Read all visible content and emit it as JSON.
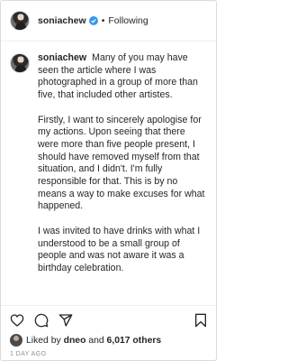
{
  "post": {
    "username": "soniachew",
    "separator": "•",
    "follow_status": "Following",
    "more_glyph": "•••"
  },
  "caption": {
    "username": "soniachew",
    "paragraphs": [
      "Many of you may have seen the article where I was photographed in a group of more than five, that included other artistes.",
      "Firstly, I want to sincerely apologise for my actions. Upon seeing that there were more than five people present, I should have removed myself from that situation, and I didn't. I'm fully responsible for that. This is by no means a way to make excuses for what happened.",
      "I was invited to have drinks with what I understood to be a small group of people and was not aware it was a birthday celebration."
    ]
  },
  "actions": {
    "icons": [
      "heart-icon",
      "comment-icon",
      "share-icon",
      "bookmark-icon"
    ]
  },
  "likes": {
    "prefix": "Liked by",
    "liker": "dneo",
    "joiner": "and",
    "others": "6,017 others"
  },
  "timestamp": "1 DAY AGO",
  "colors": {
    "text": "#262626",
    "muted": "#8e8e8e",
    "border": "#dbdbdb",
    "verified": "#3897f0"
  }
}
